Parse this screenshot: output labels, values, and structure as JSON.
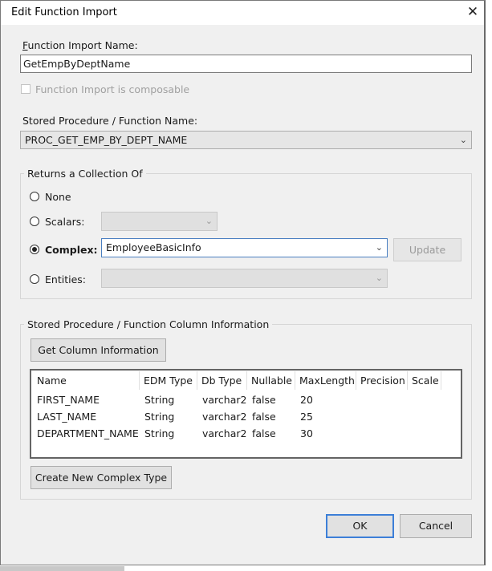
{
  "window": {
    "title": "Edit Function Import"
  },
  "function_import": {
    "name_label": "Function Import Name:",
    "name_value": "GetEmpByDeptName",
    "composable_label": "Function Import is composable"
  },
  "stored_procedure": {
    "label": "Stored Procedure / Function Name:",
    "value": "PROC_GET_EMP_BY_DEPT_NAME"
  },
  "returns": {
    "group_title": "Returns a Collection Of",
    "none_label": "None",
    "scalars_label": "Scalars:",
    "complex_label": "Complex:",
    "complex_value": "EmployeeBasicInfo",
    "entities_label": "Entities:",
    "update_button": "Update",
    "selected": "complex"
  },
  "columns": {
    "group_title": "Stored Procedure / Function Column Information",
    "get_button": "Get Column Information",
    "headers": [
      "Name",
      "EDM Type",
      "Db Type",
      "Nullable",
      "MaxLength",
      "Precision",
      "Scale"
    ],
    "rows": [
      [
        "FIRST_NAME",
        "String",
        "varchar2",
        "false",
        "20",
        "",
        ""
      ],
      [
        "LAST_NAME",
        "String",
        "varchar2",
        "false",
        "25",
        "",
        ""
      ],
      [
        "DEPARTMENT_NAME",
        "String",
        "varchar2",
        "false",
        "30",
        "",
        ""
      ]
    ],
    "create_button": "Create New Complex Type"
  },
  "footer": {
    "ok_button": "OK",
    "cancel_button": "Cancel"
  },
  "icons": {
    "close": "close-icon",
    "dropdown": "chevron-down-icon"
  }
}
